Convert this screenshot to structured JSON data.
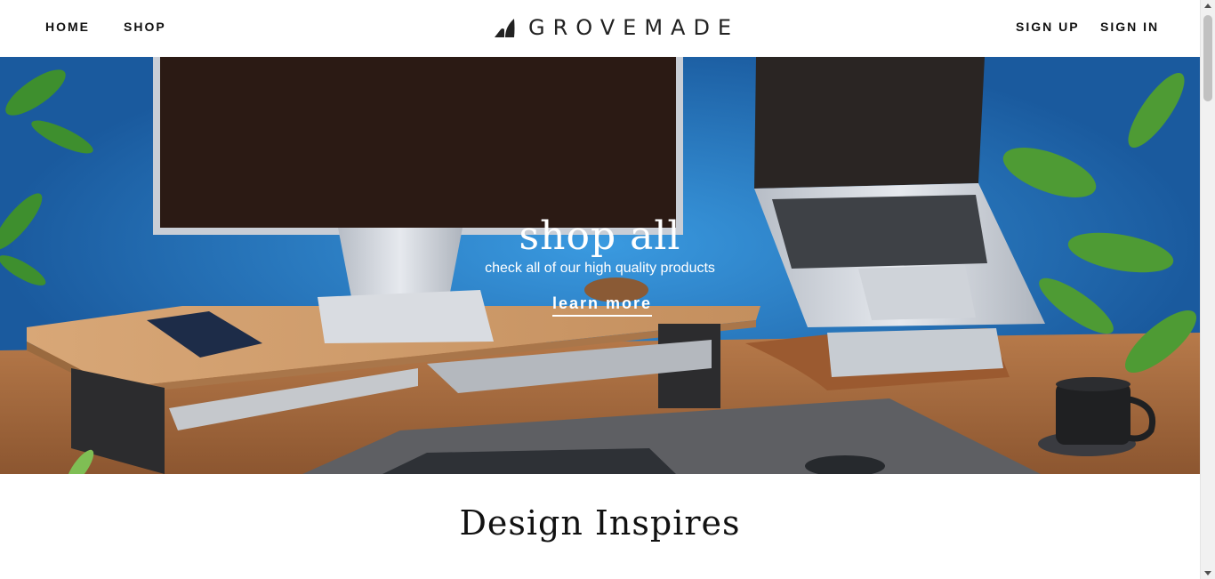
{
  "header": {
    "nav_left": [
      "HOME",
      "SHOP"
    ],
    "nav_right": [
      "SIGN UP",
      "SIGN IN"
    ],
    "logo_text": "GROVEMADE",
    "logo_icon": "leaf-drop-icon"
  },
  "hero": {
    "title": "shop all",
    "subtitle": "check all of our high quality products",
    "cta_label": "learn more",
    "image": "desk-setup-photo"
  },
  "section": {
    "title": "Design Inspires"
  },
  "colors": {
    "hero_background": "#1f6bb3",
    "text_dark": "#111111",
    "text_light": "#ffffff"
  }
}
